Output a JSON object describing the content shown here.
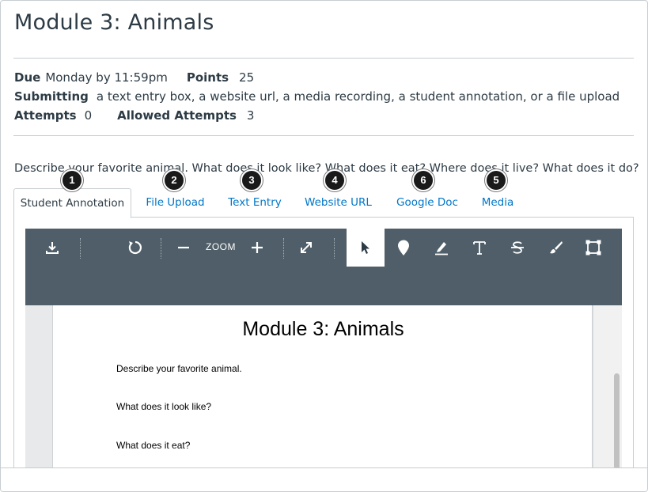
{
  "title": "Module 3: Animals",
  "details": {
    "due_label": "Due",
    "due_value": "Monday by 11:59pm",
    "points_label": "Points",
    "points_value": "25",
    "submitting_label": "Submitting",
    "submitting_value": "a text entry box, a website url, a media recording, a student annotation, or a file upload",
    "attempts_label": "Attempts",
    "attempts_value": "0",
    "allowed_label": "Allowed Attempts",
    "allowed_value": "3"
  },
  "description": "Describe your favorite animal. What does it look like? What does it eat? Where does it live? What does it do?",
  "tabs": [
    {
      "label": "Student Annotation",
      "badge": "1"
    },
    {
      "label": "File Upload",
      "badge": "2"
    },
    {
      "label": "Text Entry",
      "badge": "3"
    },
    {
      "label": "Website URL",
      "badge": "4"
    },
    {
      "label": "Google Doc",
      "badge": "6"
    },
    {
      "label": "Media",
      "badge": "5"
    }
  ],
  "toolbar": {
    "zoom_label": "ZOOM",
    "icons": [
      "download-icon",
      "rotate-icon",
      "zoom-out-icon",
      "zoom-in-icon",
      "fullscreen-icon",
      "cursor-icon",
      "pin-icon",
      "highlight-icon",
      "text-icon",
      "strikeout-icon",
      "brush-icon",
      "area-icon"
    ]
  },
  "document": {
    "heading": "Module 3: Animals",
    "lines": [
      "Describe your favorite animal.",
      "What does it look like?",
      "What does it eat?"
    ]
  },
  "colors": {
    "link": "#0077c8",
    "text": "#2d3b45",
    "toolbar": "#4f5e68",
    "badge": "#1a1a1a"
  }
}
